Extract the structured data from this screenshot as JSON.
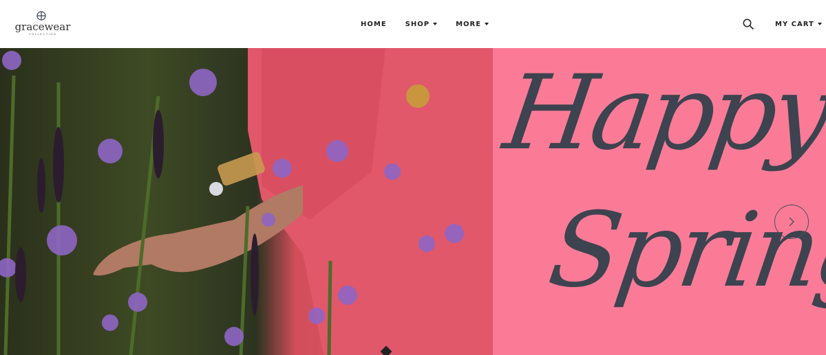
{
  "brand": {
    "name": "gracewear",
    "tagline": "COLLECTION",
    "logo_icon": "cross-circle-icon"
  },
  "nav": {
    "items": [
      {
        "label": "HOME",
        "has_dropdown": false
      },
      {
        "label": "SHOP",
        "has_dropdown": true
      },
      {
        "label": "MORE",
        "has_dropdown": true
      }
    ]
  },
  "header_actions": {
    "search_icon": "search-icon",
    "cart_label": "MY CART",
    "cart_icon": "chevron-down-icon"
  },
  "hero": {
    "headline_line1": "Happy",
    "headline_line2": "Spring",
    "next_icon": "chevron-right-icon",
    "colors": {
      "panel": "#fb7b96",
      "text": "#3d434f"
    },
    "slider_indicator": "diamond-dot"
  }
}
